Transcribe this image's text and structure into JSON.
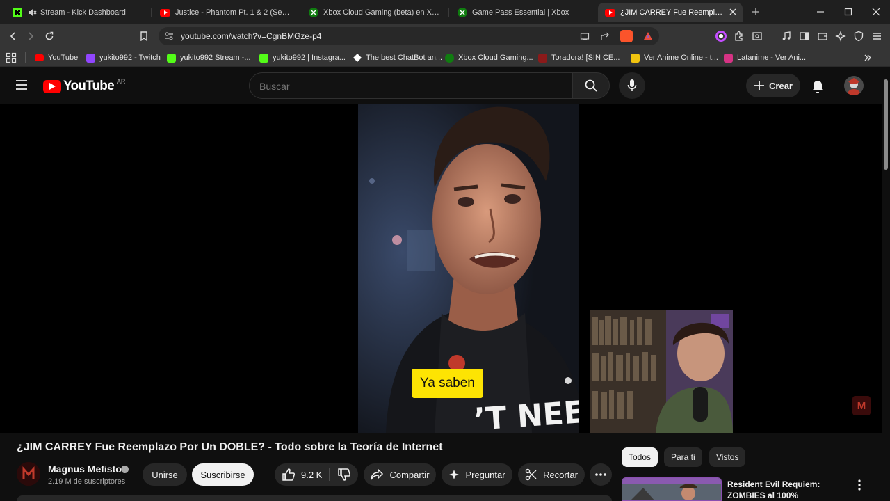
{
  "browser": {
    "tabs": [
      {
        "title": "Stream - Kick Dashboard",
        "icon": "kick-icon",
        "color": "#53fc18"
      },
      {
        "title": "Justice - Phantom Pt. 1 & 2 (Seamless",
        "icon": "youtube-icon",
        "color": "#ff0000"
      },
      {
        "title": "Xbox Cloud Gaming (beta) en Xbox.com",
        "icon": "xbox-icon",
        "color": "#107c10"
      },
      {
        "title": "Game Pass Essential | Xbox",
        "icon": "xbox-icon",
        "color": "#107c10"
      },
      {
        "title": "¿JIM CARREY Fue Reemplazo Por",
        "icon": "youtube-icon",
        "color": "#ff0000",
        "active": true
      }
    ],
    "url": "youtube.com/watch?v=CgnBMGze-p4",
    "bookmarks": [
      {
        "label": "YouTube",
        "icon": "youtube-icon",
        "color": "#ff0000"
      },
      {
        "label": "yukito992 - Twitch",
        "icon": "twitch-icon",
        "color": "#9146ff"
      },
      {
        "label": "yukito992 Stream -...",
        "icon": "kick-icon",
        "color": "#53fc18"
      },
      {
        "label": "yukito992 | Instagra...",
        "icon": "kick-icon",
        "color": "#53fc18"
      },
      {
        "label": "The best ChatBot an...",
        "icon": "chatbot-icon",
        "color": "#ffffff"
      },
      {
        "label": "Xbox Cloud Gaming...",
        "icon": "xbox-icon",
        "color": "#107c10"
      },
      {
        "label": "Toradora! [SIN CE...",
        "icon": "anime-icon",
        "color": "#c0392b"
      },
      {
        "label": "Ver Anime Online - t...",
        "icon": "anime-icon",
        "color": "#f1c40f"
      },
      {
        "label": "Latanime - Ver Ani...",
        "icon": "latanime-icon",
        "color": "#d63384"
      }
    ]
  },
  "youtube": {
    "logo_text": "YouTube",
    "country": "AR",
    "search_placeholder": "Buscar",
    "create_label": "Crear",
    "subtitle": "Ya saben",
    "watermark": "M",
    "video_title": "¿JIM CARREY Fue Reemplazo Por Un DOBLE? - Todo sobre la Teoría de Internet",
    "channel": {
      "name": "Magnus Mefisto",
      "subscribers": "2.19 M de suscriptores",
      "join_label": "Unirse",
      "subscribe_label": "Suscribirse"
    },
    "actions": {
      "likes": "9.2 K",
      "share": "Compartir",
      "ask": "Preguntar",
      "clip": "Recortar"
    },
    "chips": [
      "Todos",
      "Para ti",
      "Vistos"
    ],
    "suggestion": {
      "title": "Resident Evil Requiem: ZOMBIES al 100%"
    }
  }
}
